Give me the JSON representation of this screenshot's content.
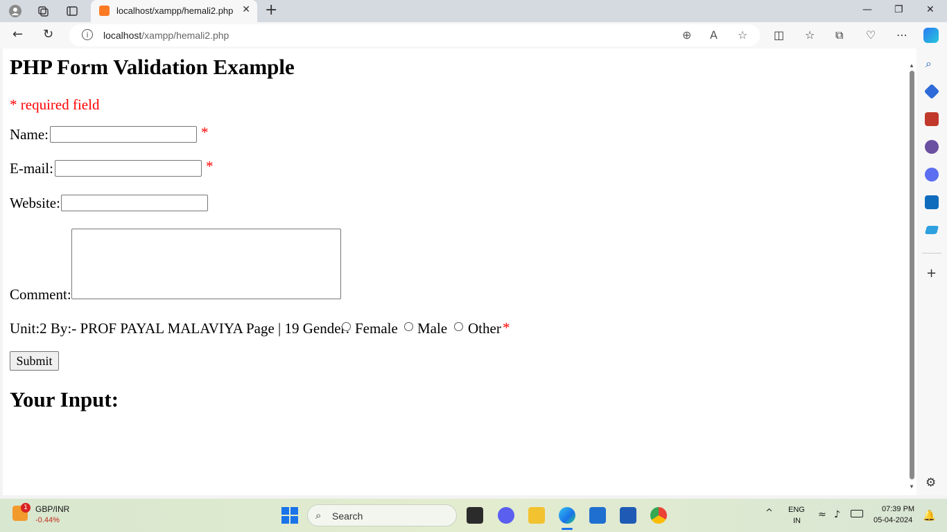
{
  "browser": {
    "tab_title": "localhost/xampp/hemali2.php",
    "url_host": "localhost",
    "url_path": "/xampp/hemali2.php"
  },
  "page": {
    "heading": "PHP Form Validation Example",
    "required_note": "* required field",
    "name_label": "Name:",
    "email_label": "E-mail:",
    "website_label": "Website:",
    "comment_label": "Comment:",
    "required_star": "*",
    "gender_prefix": "Unit:2 By:- PROF PAYAL MALAVIYA Page | 19 Gender:",
    "gender_options": [
      "Female",
      "Male",
      "Other"
    ],
    "submit_label": "Submit",
    "output_heading": "Your Input:"
  },
  "taskbar": {
    "weather_badge": "1",
    "ticker_name": "GBP/INR",
    "ticker_value": "-0.44%",
    "search_placeholder": "Search",
    "lang_top": "ENG",
    "lang_bottom": "IN",
    "time": "07:39 PM",
    "date": "05-04-2024"
  },
  "colors": {
    "required_red": "#ff0000",
    "taskbar_accent": "#1a73e8"
  }
}
